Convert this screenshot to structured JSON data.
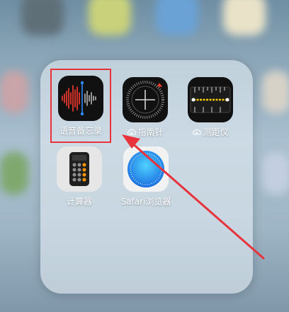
{
  "folder": {
    "apps": [
      {
        "label": "语音备忘录",
        "icon": "voice-memos-icon",
        "cloud": false
      },
      {
        "label": "指南针",
        "icon": "compass-icon",
        "cloud": true
      },
      {
        "label": "测距仪",
        "icon": "measure-icon",
        "cloud": true
      },
      {
        "label": "计算器",
        "icon": "calculator-icon",
        "cloud": false
      },
      {
        "label": "Safari浏览器",
        "icon": "safari-icon",
        "cloud": false
      }
    ]
  },
  "annotation": {
    "highlight_color": "#e8323c",
    "target": "语音备忘录"
  }
}
